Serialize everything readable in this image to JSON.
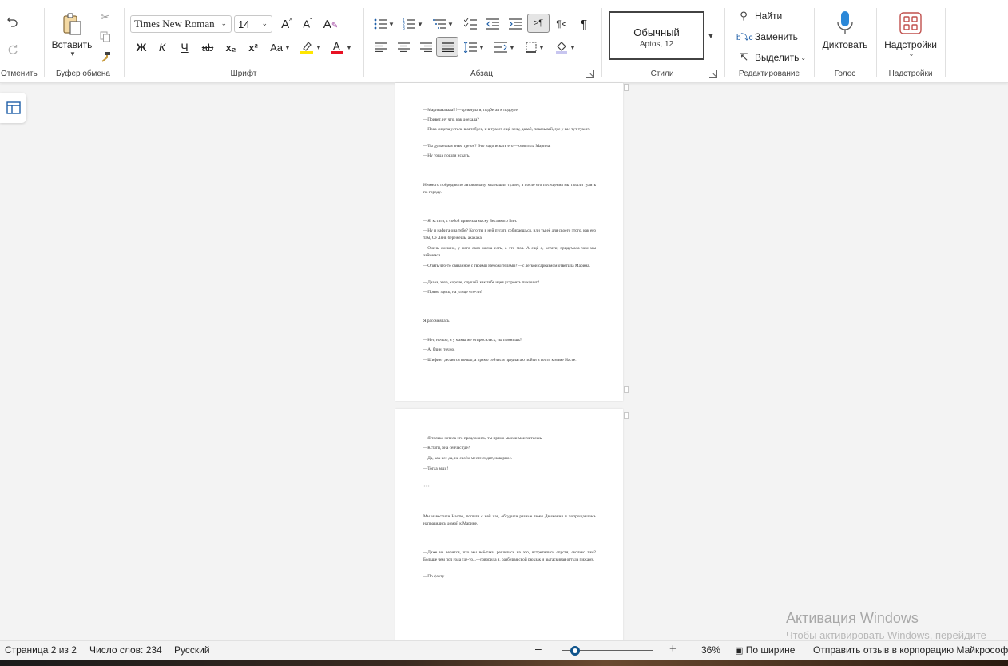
{
  "ribbon": {
    "undo": {
      "label": "Отменить"
    },
    "clipboard": {
      "paste_label": "Вставить",
      "group_label": "Буфер обмена"
    },
    "font": {
      "name": "Times New Roman",
      "size": "14",
      "group_label": "Шрифт",
      "bold": "Ж",
      "italic": "К",
      "underline": "Ч",
      "strike": "ab",
      "sub": "x₂",
      "sup": "x²",
      "case": "Aa",
      "grow": "A^",
      "shrink": "Aˇ",
      "highlight_color": "#ffe600",
      "font_color": "#e81123"
    },
    "paragraph": {
      "group_label": "Абзац"
    },
    "styles": {
      "current": "Обычный",
      "current_font": "Aptos, 12",
      "group_label": "Стили"
    },
    "editing": {
      "find": "Найти",
      "replace": "Заменить",
      "select": "Выделить",
      "group_label": "Редактирование"
    },
    "voice": {
      "dictate": "Диктовать",
      "group_label": "Голос"
    },
    "addins": {
      "label": "Надстройки",
      "group_label": "Надстройки"
    }
  },
  "document": {
    "page1": [
      "—Маринааааааа!!!—крикнула я, подбегая к подруге.",
      "—Привет, ну что, как доехала?",
      "—Пока сидела устала в автобусе, и в туалет ещё хочу, давай, показывай, где у вас тут туалет.",
      "—Ты думаешь я знаю где он? Это надо искать его.—ответила Марина.",
      "—Ну тогда пошли искать.",
      "Немного побродив по автовокзалу, мы нашли туалет, а после его посещения мы пошли гулять по городу.",
      "—Я, кстати, с собой привезла маску Бесликого Бин.",
      "—Ну и нафига она тебе? Кого ты в ней пугать собираешься, или ты её для своего этого, как его там, Се Лянь бережёшь, ахахаха.",
      "—Очень смешно, у него своя маска есть, а это моя. А ещё я, кстати, придумала чем мы займемся.",
      "—Опять что-то связанное с твоими Небожителями? —с легкой сарказмом ответила Марина.",
      "—Даааа, хехе, короче, слушай, как тебе идея устроить пикфинг?",
      "—Прямо здесь, на улице что-ли?",
      "Я рассмеялась.",
      "—Нет, ночью, я у мамы же отпросилась, ты помнишь?",
      "—А, блин, точно.",
      "—Шифинг делается ночью, а прямо сейчас я предлагаю пойти в гости к маме Насте."
    ],
    "page2": [
      "—Я только хотела это предложить, ты прямо мысли мои читаешь.",
      "—Кстати, она сейчас где?",
      "—Да, как все да, на своём месте сидит, наверное.",
      "—Тогда веди!",
      "***",
      "Мы навестили Настю, попили с ней чая, обсудили разные темы Движения и попрощавшись направились домой к Марине.",
      "—Даже не верится, что мы всё-таки решились на это, встретились спустя, сколько там? Больше чем пол года где-то...—говорила я, разбирая свой рюкзак и вытаскивая оттуда пижаму.",
      "—По факту."
    ]
  },
  "status": {
    "page": "Страница 2 из 2",
    "words": "Число слов: 234",
    "language": "Русский",
    "zoom": "36%",
    "zoom_value_percent": 36,
    "fit": "По ширине",
    "feedback": "Отправить отзыв в корпорацию Майкрософт"
  },
  "watermark": {
    "line1": "Активация Windows",
    "line2": "Чтобы активировать Windows, перейдите"
  }
}
